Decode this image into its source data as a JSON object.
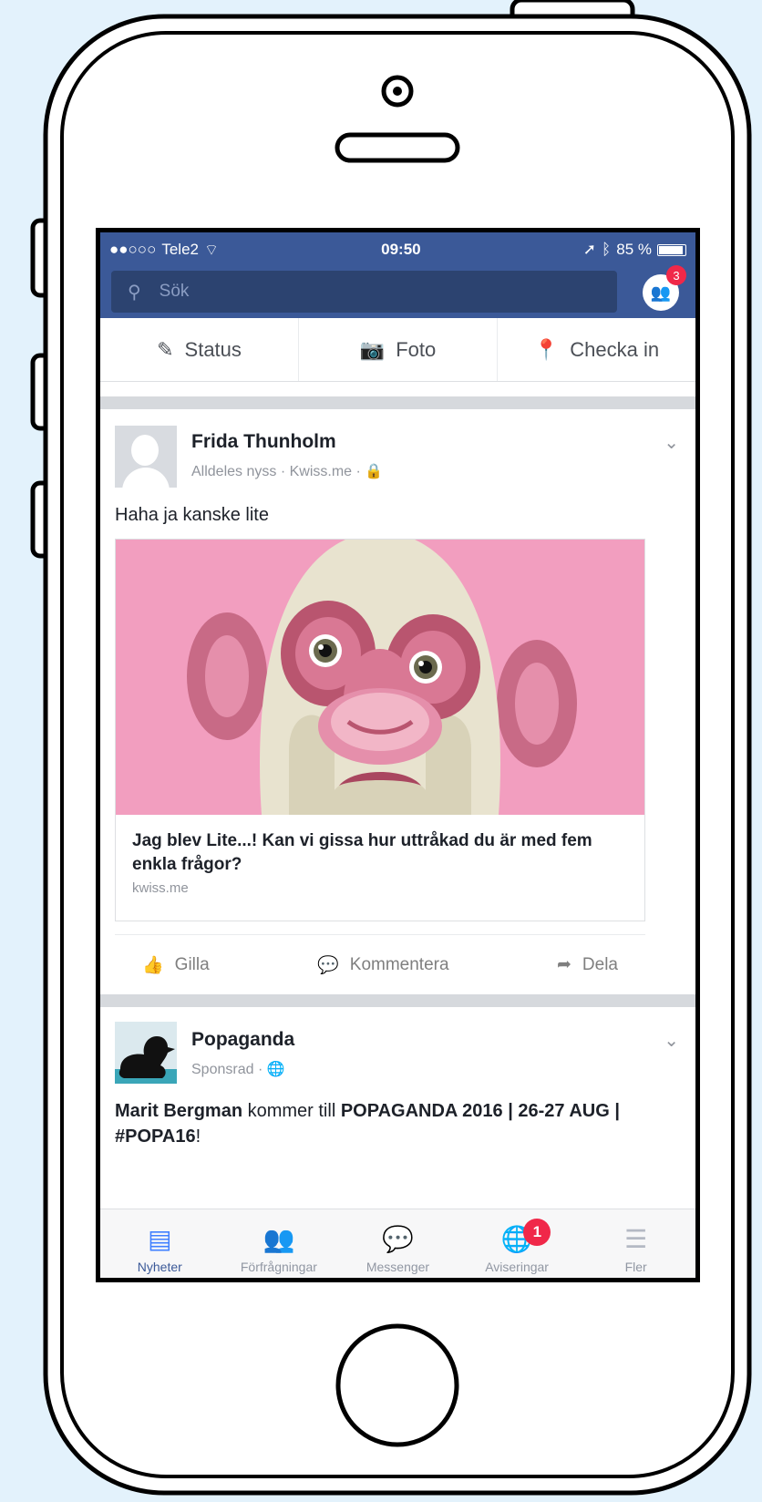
{
  "colors": {
    "background": "#e3f2fc",
    "facebook_blue": "#3b5998",
    "badge_red": "#f02849",
    "active_tab": "#4080ff"
  },
  "statusbar": {
    "carrier": "Tele2",
    "time": "09:50",
    "battery": "85 %"
  },
  "header": {
    "search_placeholder": "Sök",
    "friend_requests_count": "3"
  },
  "composer": {
    "status_label": "Status",
    "photo_label": "Foto",
    "checkin_label": "Checka in"
  },
  "post1": {
    "author": "Frida Thunholm",
    "meta": "Alldeles nyss · Kwiss.me ·",
    "text": "Haha ja kanske lite",
    "link_title": "Jag blev Lite...! Kan vi gissa hur uttråkad du är med fem enkla frågor?",
    "link_domain": "kwiss.me",
    "actions": {
      "like": "Gilla",
      "comment": "Kommentera",
      "share": "Dela"
    }
  },
  "post2": {
    "author": "Popaganda",
    "meta": "Sponsrad ·",
    "text_strong1": "Marit Bergman",
    "text_mid": " kommer till ",
    "text_strong2": "POPAGANDA 2016 | 26-27 AUG | #POPA16",
    "text_end": "!"
  },
  "tabbar": {
    "tabs": [
      "Nyheter",
      "Förfrågningar",
      "Messenger",
      "Aviseringar",
      "Fler"
    ],
    "notifications_count": "1"
  }
}
